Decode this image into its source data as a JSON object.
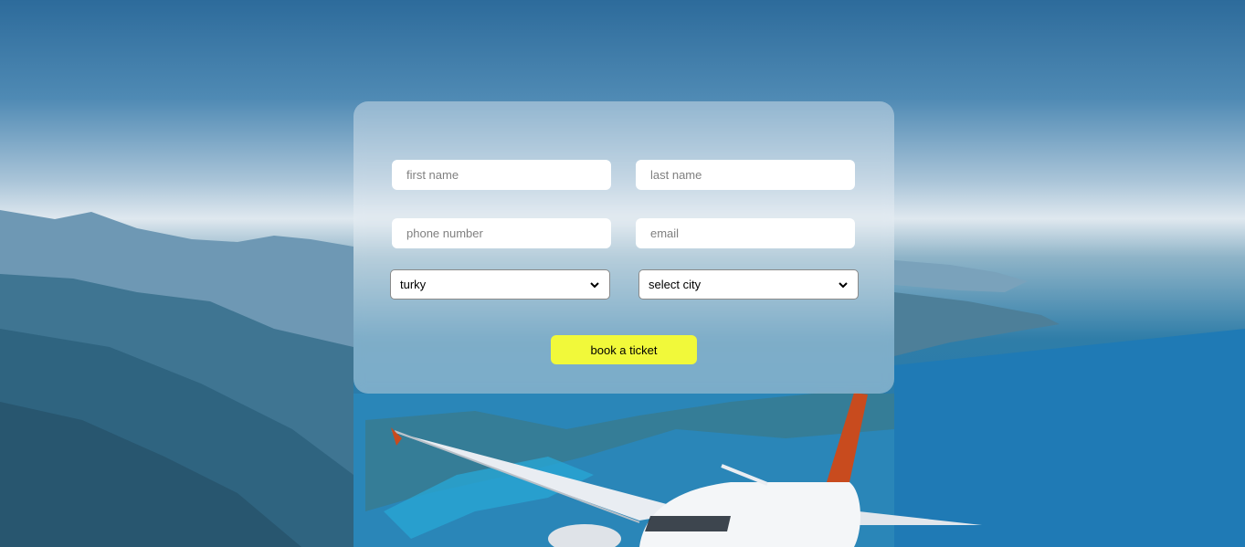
{
  "form": {
    "first_name": {
      "value": "",
      "placeholder": "first name"
    },
    "last_name": {
      "value": "",
      "placeholder": "last name"
    },
    "phone": {
      "value": "",
      "placeholder": "phone number"
    },
    "email": {
      "value": "",
      "placeholder": "email"
    },
    "country_select": {
      "selected": "turky"
    },
    "city_select": {
      "selected": "select city"
    },
    "submit_label": "book a ticket"
  },
  "colors": {
    "button": "#f1f93a",
    "card": "rgba(235,240,246,0.42)",
    "sea": "#1a78b2"
  },
  "background": {
    "icon": "airplane-over-coast-photo"
  }
}
